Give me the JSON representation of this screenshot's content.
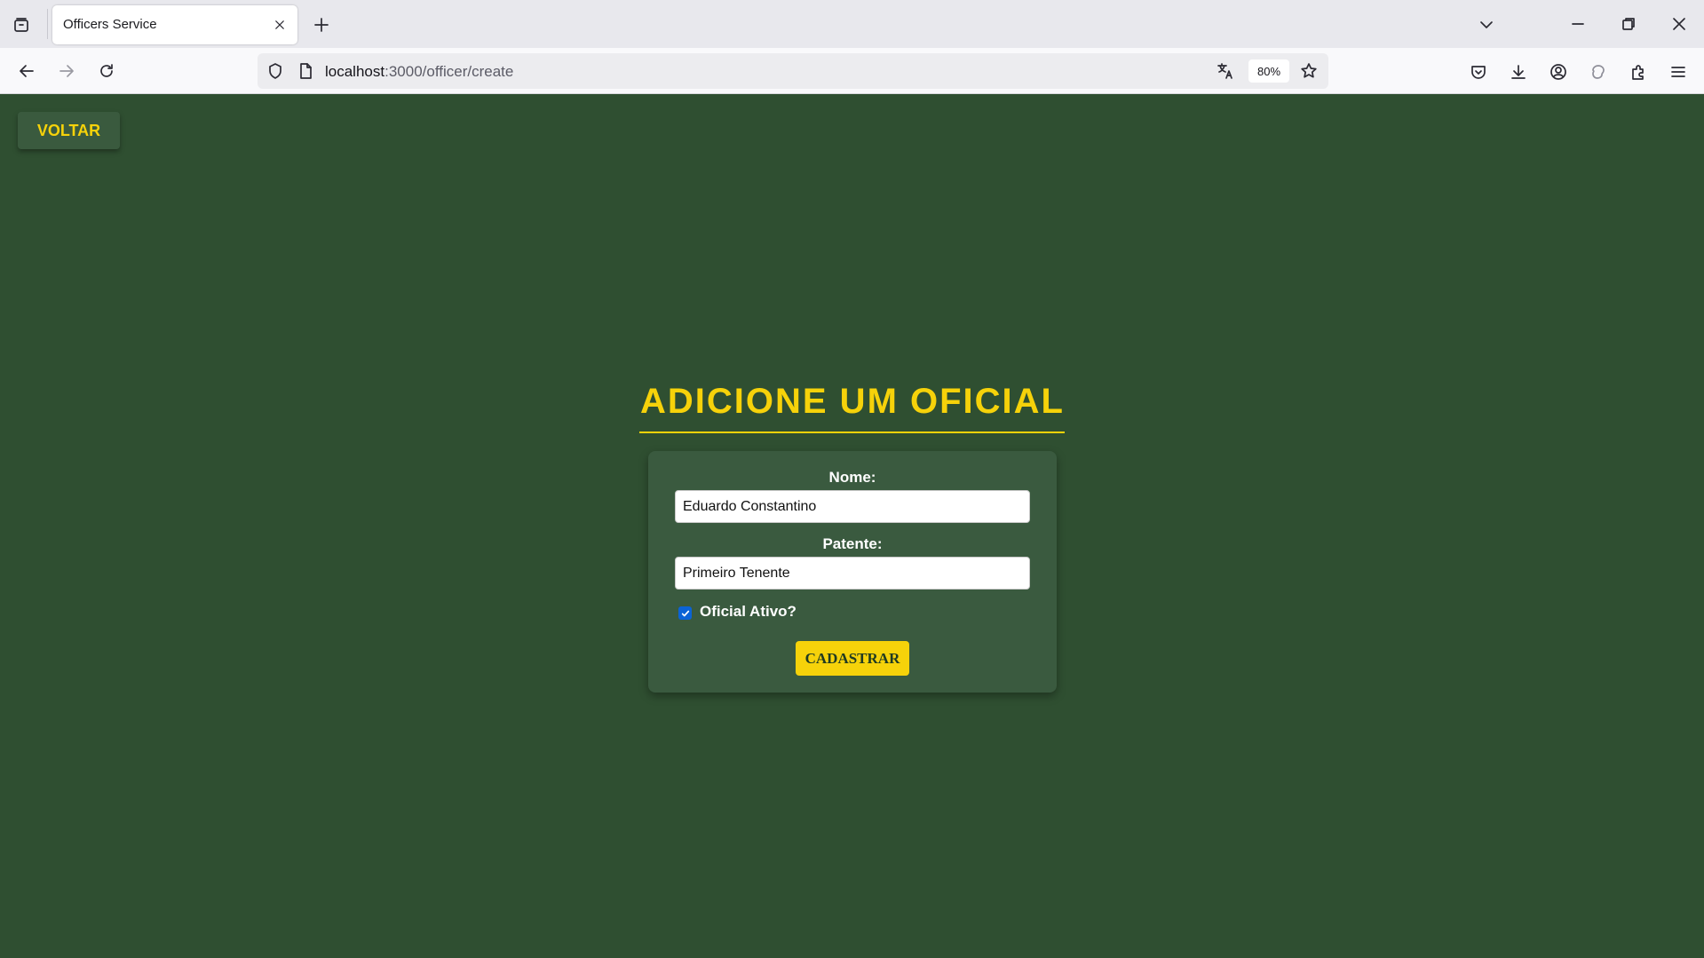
{
  "browser": {
    "tab_title": "Officers Service",
    "url_host": "localhost",
    "url_rest": ":3000/officer/create",
    "zoom": "80%"
  },
  "page": {
    "back_label": "VOLTAR",
    "heading": "ADICIONE UM OFICIAL",
    "form": {
      "name_label": "Nome:",
      "name_value": "Eduardo Constantino",
      "rank_label": "Patente:",
      "rank_value": "Primeiro Tenente",
      "active_label": "Oficial Ativo?",
      "active_checked": true,
      "submit_label": "CADASTRAR"
    }
  },
  "colors": {
    "background": "#2f4f31",
    "accent": "#f6d20a",
    "card": "#3a5a3f"
  }
}
